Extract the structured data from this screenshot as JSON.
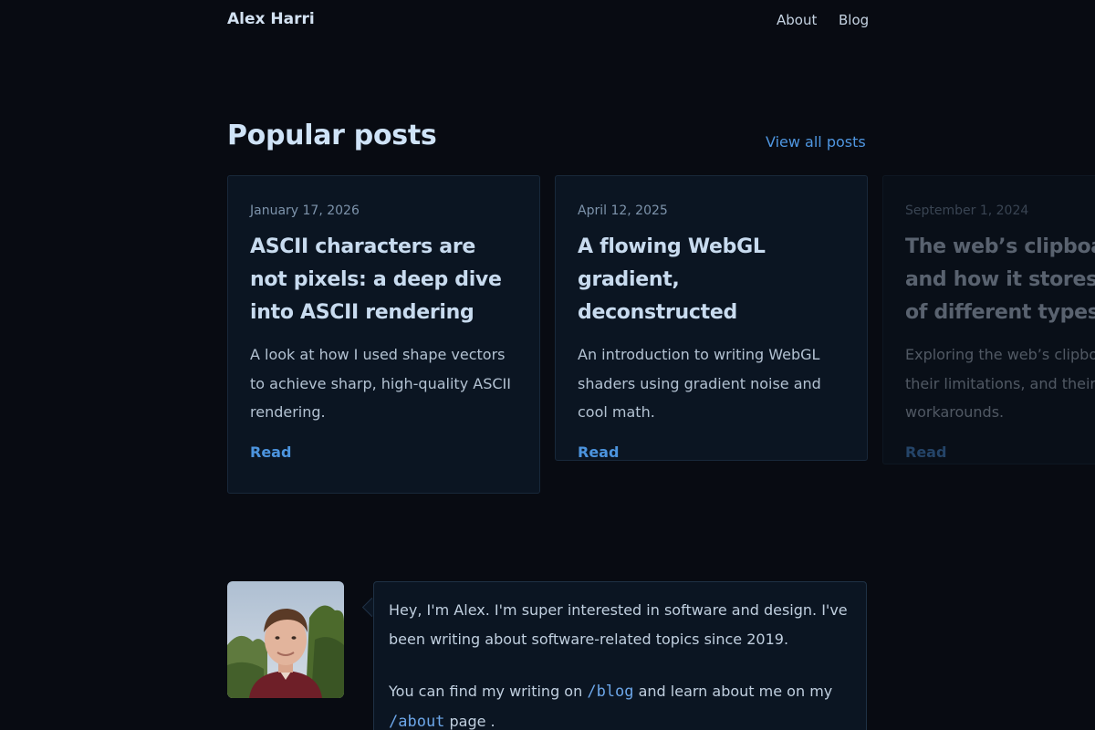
{
  "header": {
    "site_name": "Alex Harri",
    "nav": [
      {
        "label": "About"
      },
      {
        "label": "Blog"
      }
    ]
  },
  "popular": {
    "heading": "Popular posts",
    "view_all_label": "View all posts",
    "posts": [
      {
        "date": "January 17, 2026",
        "title": "ASCII characters are not pixels: a deep dive into ASCII rendering",
        "description": "A look at how I used shape vectors to achieve sharp, high-quality ASCII rendering.",
        "read_label": "Read"
      },
      {
        "date": "April 12, 2025",
        "title": "A flowing WebGL gradient, deconstructed",
        "description": "An introduction to writing WebGL shaders using gradient noise and cool math.",
        "read_label": "Read"
      },
      {
        "date": "September 1, 2024",
        "title": "The web’s clipboard, and how it stores data of different types",
        "description": "Exploring the web’s clipboard APIs, their limitations, and their workarounds.",
        "read_label": "Read"
      }
    ]
  },
  "bio": {
    "intro": "Hey, I'm Alex. I'm super interested in software and design. I've been writing about software-related topics since 2019.",
    "text_before_blog": "You can find my writing on ",
    "blog_link": "/blog",
    "text_between": " and learn about me on my ",
    "about_link": "/about",
    "text_after": " page ."
  },
  "colors": {
    "background": "#080b12",
    "card_background": "#0b1522",
    "accent": "#4c94de",
    "heading": "#cfe3f7"
  },
  "icons": {
    "avatar": "portrait-photo"
  }
}
